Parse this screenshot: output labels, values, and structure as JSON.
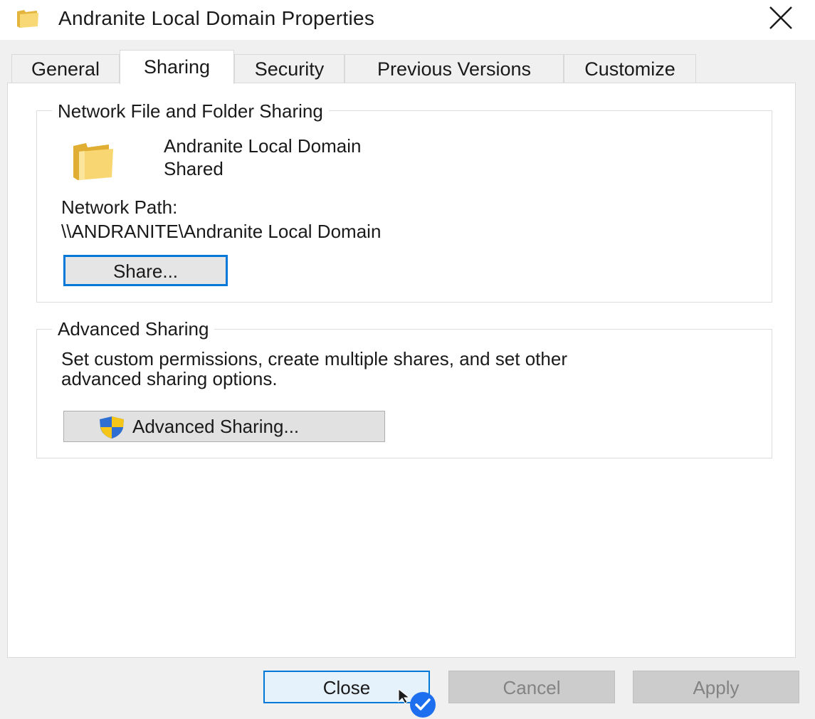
{
  "window": {
    "title": "Andranite Local Domain Properties"
  },
  "tabs": [
    {
      "label": "General",
      "active": false
    },
    {
      "label": "Sharing",
      "active": true
    },
    {
      "label": "Security",
      "active": false
    },
    {
      "label": "Previous Versions",
      "active": false
    },
    {
      "label": "Customize",
      "active": false
    }
  ],
  "network_sharing": {
    "legend": "Network File and Folder Sharing",
    "folder_name": "Andranite Local Domain",
    "status": "Shared",
    "path_label": "Network Path:",
    "path_value": "\\\\ANDRANITE\\Andranite Local Domain",
    "share_button": "Share..."
  },
  "advanced_sharing": {
    "legend": "Advanced Sharing",
    "description_line1": "Set custom permissions, create multiple shares, and set other",
    "description_line2": "advanced sharing options.",
    "button_label": "Advanced Sharing..."
  },
  "footer": {
    "close_label": "Close",
    "cancel_label": "Cancel",
    "apply_label": "Apply"
  },
  "colors": {
    "accent": "#0078d7",
    "folder": "#f3c94f",
    "shield_blue": "#2f6fd1",
    "shield_yellow": "#f5c518"
  }
}
